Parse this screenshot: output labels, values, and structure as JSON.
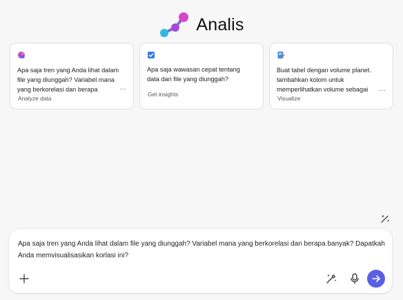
{
  "header": {
    "title": "Analis",
    "logo_icon": "analyst-molecule-icon"
  },
  "cards": [
    {
      "icon": "pie-chart-icon",
      "text": "Apa saja tren yang Anda lihat dalam file yang diunggah? Variabel mana yang berkorelasi dan berapa banyak? Bisa",
      "tag": "Analyze data",
      "more": "..."
    },
    {
      "icon": "checkbox-insight-icon",
      "text": "Apa saja wawasan cepat tentang data dari file yang diunggah?",
      "tag": "Get insights"
    },
    {
      "icon": "visualize-document-icon",
      "text": "Buat tabel dengan volume planet. tambahkan kolom untuk memperlihatkan volume sebagai kelipatan Bumi. dan",
      "tag": "Visualize",
      "more": "..."
    }
  ],
  "composer": {
    "text": "Apa saja tren yang Anda lihat dalam file yang diunggah? Variabel mana yang berkorelasi dan berapa banyak? Dapatkah Anda memvisualisasikan korlasi ini?"
  },
  "colors": {
    "accent": "#5b5fe3",
    "logo_pink": "#d040c8",
    "logo_purple": "#a44ad8",
    "logo_cyan": "#31b8e6"
  }
}
